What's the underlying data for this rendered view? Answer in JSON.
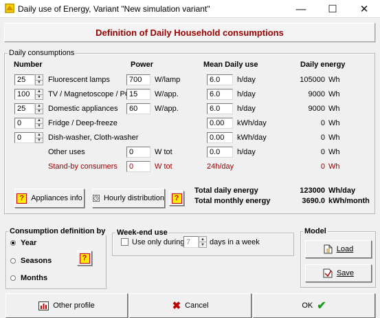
{
  "window": {
    "title": "Daily use of Energy, Variant  \"New simulation variant\"",
    "minimize": "—",
    "maximize": "☐",
    "close": "✕"
  },
  "banner": "Definition of Daily Household consumptions",
  "daily": {
    "legend": "Daily consumptions",
    "headers": {
      "number": "Number",
      "power": "Power",
      "mean": "Mean Daily use",
      "energy": "Daily energy"
    },
    "rows": [
      {
        "number": "25",
        "label": "Fluorescent lamps",
        "power": "700",
        "power_unit": "W/lamp",
        "mean": "6.0",
        "mean_unit": "h/day",
        "energy": "105000",
        "energy_unit": "Wh"
      },
      {
        "number": "100",
        "label": "TV / Magnetoscope / PC",
        "power": "15",
        "power_unit": "W/app.",
        "mean": "6.0",
        "mean_unit": "h/day",
        "energy": "9000",
        "energy_unit": "Wh"
      },
      {
        "number": "25",
        "label": "Domestic appliances",
        "power": "60",
        "power_unit": "W/app.",
        "mean": "6.0",
        "mean_unit": "h/day",
        "energy": "9000",
        "energy_unit": "Wh"
      },
      {
        "number": "0",
        "label": "Fridge / Deep-freeze",
        "mean": "0.00",
        "mean_unit": "kWh/day",
        "energy": "0",
        "energy_unit": "Wh"
      },
      {
        "number": "0",
        "label": "Dish-washer,  Cloth-washer",
        "mean": "0.00",
        "mean_unit": "kWh/day",
        "energy": "0",
        "energy_unit": "Wh"
      },
      {
        "label": "Other uses",
        "power": "0",
        "power_unit": "W tot",
        "mean": "0.0",
        "mean_unit": "h/day",
        "energy": "0",
        "energy_unit": "Wh"
      },
      {
        "label": "Stand-by consumers",
        "power": "0",
        "power_unit": "W tot",
        "mean_text": "24h/day",
        "energy": "0",
        "energy_unit": "Wh"
      }
    ],
    "appliances_info": "Appliances info",
    "hourly_distribution": "Hourly distribution",
    "help": "?",
    "total_daily_label": "Total daily energy",
    "total_daily_value": "123000",
    "total_daily_unit": "Wh/day",
    "total_monthly_label": "Total monthly energy",
    "total_monthly_value": "3690.0",
    "total_monthly_unit": "kWh/month"
  },
  "consumption_def": {
    "legend": "Consumption definition by",
    "options": [
      "Year",
      "Seasons",
      "Months"
    ],
    "selected": "Year",
    "help": "?"
  },
  "weekend": {
    "legend": "Week-end use",
    "checkbox_label": "Use only during",
    "days_value": "7",
    "days_suffix": "days in a week"
  },
  "model": {
    "legend": "Model",
    "load": "Load",
    "save": "Save"
  },
  "footer": {
    "other_profile": "Other profile",
    "cancel": "Cancel",
    "ok": "OK"
  }
}
